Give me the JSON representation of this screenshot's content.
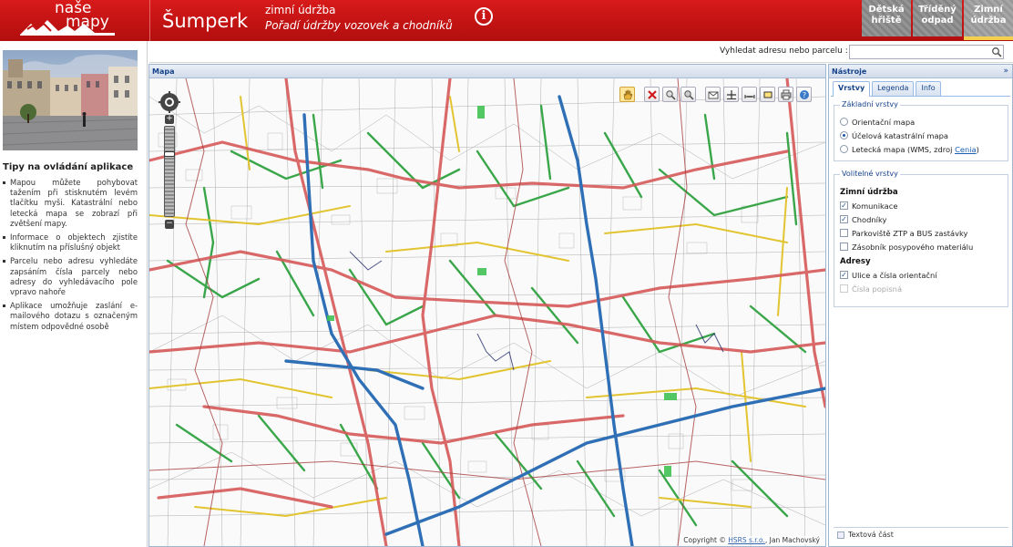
{
  "header": {
    "logo_line1": "naše",
    "logo_line2": "mapy",
    "city": "Šumperk",
    "subtitle": "zimní údržba",
    "subtitle_italic": "Pořadí údržby vozovek a chodníků",
    "info_symbol": "i",
    "app_tabs": [
      {
        "line1": "Dětská",
        "line2": "hřiště"
      },
      {
        "line1": "Tříděný",
        "line2": "odpad"
      },
      {
        "line1": "Zimní",
        "line2": "údržba"
      }
    ]
  },
  "search": {
    "label": "Vyhledat adresu nebo parcelu :",
    "value": "",
    "placeholder": ""
  },
  "left": {
    "tips_title": "Tipy na ovládání aplikace",
    "tips": [
      "Mapou můžete pohybovat tažením při stisknutém levém tlačítku myši. Katastrální nebo letecká mapa se zobrazí při zvětšení mapy.",
      "Informace o objektech zjistíte kliknutím na příslušný objekt",
      "Parcelu nebo adresu vyhledáte zapsáním čísla parcely nebo adresy do vyhledávacího pole vpravo nahoře",
      "Aplikace umožňuje zaslání e-mailového dotazu s označeným místem odpovědné osobě"
    ]
  },
  "map": {
    "panel_title": "Mapa",
    "copyright_prefix": "Copyright ©",
    "copyright_link": "HSRS s.r.o.",
    "copyright_suffix": ", Jan Machovský",
    "zoom_plus": "+",
    "zoom_minus": "−"
  },
  "tools": {
    "panel_title": "Nástroje",
    "collapse_symbol": "»",
    "tabs": [
      "Vrstvy",
      "Legenda",
      "Info"
    ],
    "base_legend": "Základní vrstvy",
    "base_layers": [
      {
        "label": "Orientační mapa",
        "checked": false
      },
      {
        "label": "Účelová katastrální mapa",
        "checked": true
      },
      {
        "label": "Letecká mapa (WMS, zdroj ",
        "link": "Cenia",
        "suffix": ")",
        "checked": false
      }
    ],
    "optional_legend": "Volitelné vrstvy",
    "group1": "Zimní údržba",
    "group1_items": [
      {
        "label": "Komunikace",
        "checked": true
      },
      {
        "label": "Chodníky",
        "checked": true
      },
      {
        "label": "Parkoviště ZTP a BUS zastávky",
        "checked": false
      },
      {
        "label": "Zásobník posypového materiálu",
        "checked": false
      }
    ],
    "group2": "Adresy",
    "group2_items": [
      {
        "label": "Ulice a čísla orientační",
        "checked": true
      },
      {
        "label": "Čísla popisná",
        "checked": false,
        "disabled": true
      }
    ],
    "text_part": "Textová část"
  },
  "colors": {
    "brand_red": "#c41414",
    "road_red": "#d65a5a",
    "road_blue": "#2f6fb5",
    "road_green": "#3aa64a",
    "road_yellow": "#e2c431",
    "panel_blue": "#15428b"
  }
}
